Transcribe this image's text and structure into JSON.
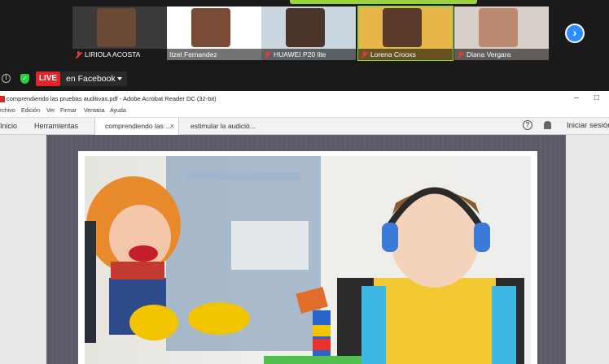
{
  "participants": [
    {
      "name": "LIRIOLA ACOSTA",
      "muted": true,
      "bg": "#3b3b3b",
      "face": "#6a4a35"
    },
    {
      "name": "Itzel Fernandez",
      "muted": false,
      "bg": "#ffffff",
      "face": "#7a4b35"
    },
    {
      "name": "HUAWEI P20 lite",
      "muted": true,
      "bg": "#c9d6e0",
      "face": "#4a3528"
    },
    {
      "name": "Lorena Crooxs",
      "muted": true,
      "bg": "#e7b64a",
      "face": "#5a3a28",
      "active": true
    },
    {
      "name": "Diana Vergara",
      "muted": true,
      "bg": "#d8cfc8",
      "face": "#b98a70"
    }
  ],
  "live": {
    "badge": "LIVE",
    "destination": "en Facebook"
  },
  "acrobat": {
    "title": "comprendiendo las pruebas auditivas.pdf - Adobe Acrobat Reader DC (32-bit)",
    "menu": [
      "rchivo",
      "Edición",
      "Ver",
      "Firmar",
      "Ventana",
      "Ayuda"
    ],
    "nav_tabs": [
      "Inicio",
      "Herramientas"
    ],
    "doc_tabs": [
      {
        "label": "comprendiendo las ...",
        "active": true
      },
      {
        "label": "estimular la audició...",
        "active": false
      }
    ],
    "signin": "Iniciar sesión"
  },
  "colors": {
    "live_red": "#e0262b",
    "zoom_blue": "#2d8cff",
    "active_border": "#9bd33a",
    "pdf_frame": "#5b5b68"
  }
}
